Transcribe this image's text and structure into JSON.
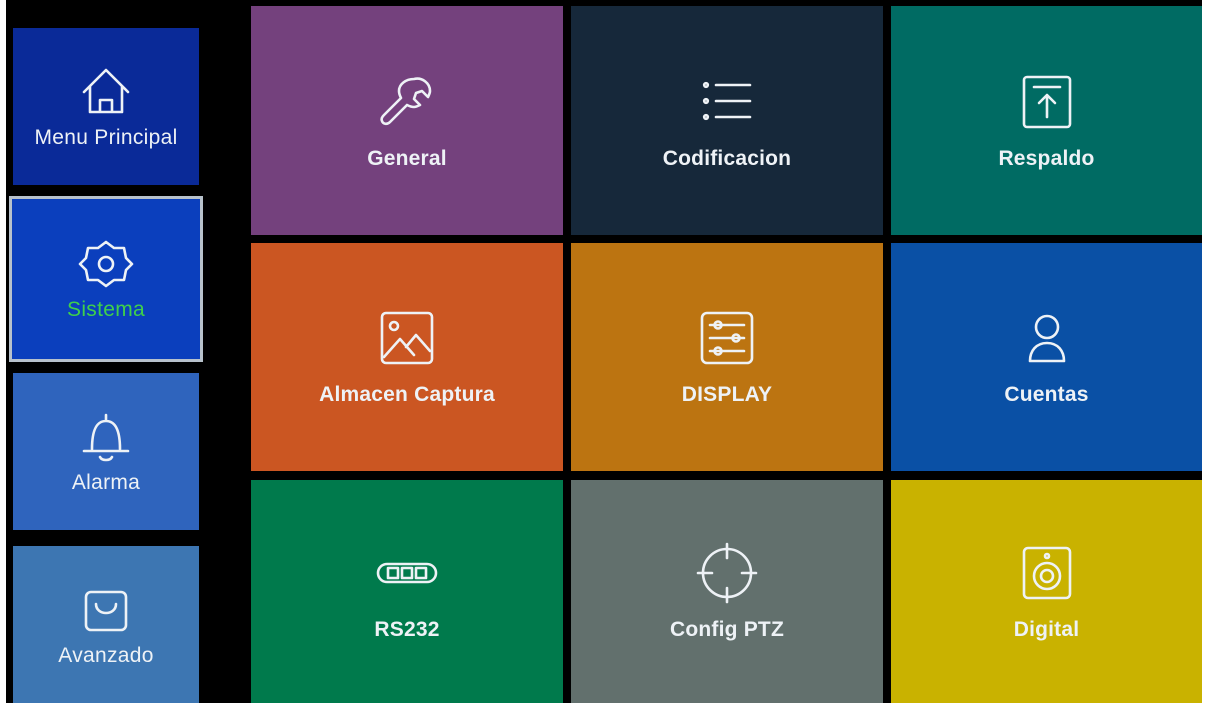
{
  "sidebar": {
    "items": [
      {
        "label": "Menu Principal",
        "icon": "home-icon",
        "color": "#0a2a98"
      },
      {
        "label": "Sistema",
        "icon": "gear-icon",
        "color": "#0b3fbd",
        "selected": true,
        "label_color": "#3fd04a"
      },
      {
        "label": "Alarma",
        "icon": "bell-icon",
        "color": "#2f64bd"
      },
      {
        "label": "Avanzado",
        "icon": "shopping-bag-icon",
        "color": "#3d76b2"
      }
    ]
  },
  "tiles": [
    {
      "label": "General",
      "icon": "wrench-icon",
      "color": "#74417d"
    },
    {
      "label": "Codificacion",
      "icon": "list-icon",
      "color": "#16283a"
    },
    {
      "label": "Respaldo",
      "icon": "upload-icon",
      "color": "#006b63"
    },
    {
      "label": "Almacen Captura",
      "icon": "image-icon",
      "color": "#cb5622"
    },
    {
      "label": "DISPLAY",
      "icon": "sliders-icon",
      "color": "#bc7411"
    },
    {
      "label": "Cuentas",
      "icon": "user-icon",
      "color": "#0a50a5"
    },
    {
      "label": "RS232",
      "icon": "serial-port-icon",
      "color": "#007a4c"
    },
    {
      "label": "Config PTZ",
      "icon": "crosshair-icon",
      "color": "#62706d"
    },
    {
      "label": "Digital",
      "icon": "speaker-icon",
      "color": "#c9b200"
    }
  ]
}
